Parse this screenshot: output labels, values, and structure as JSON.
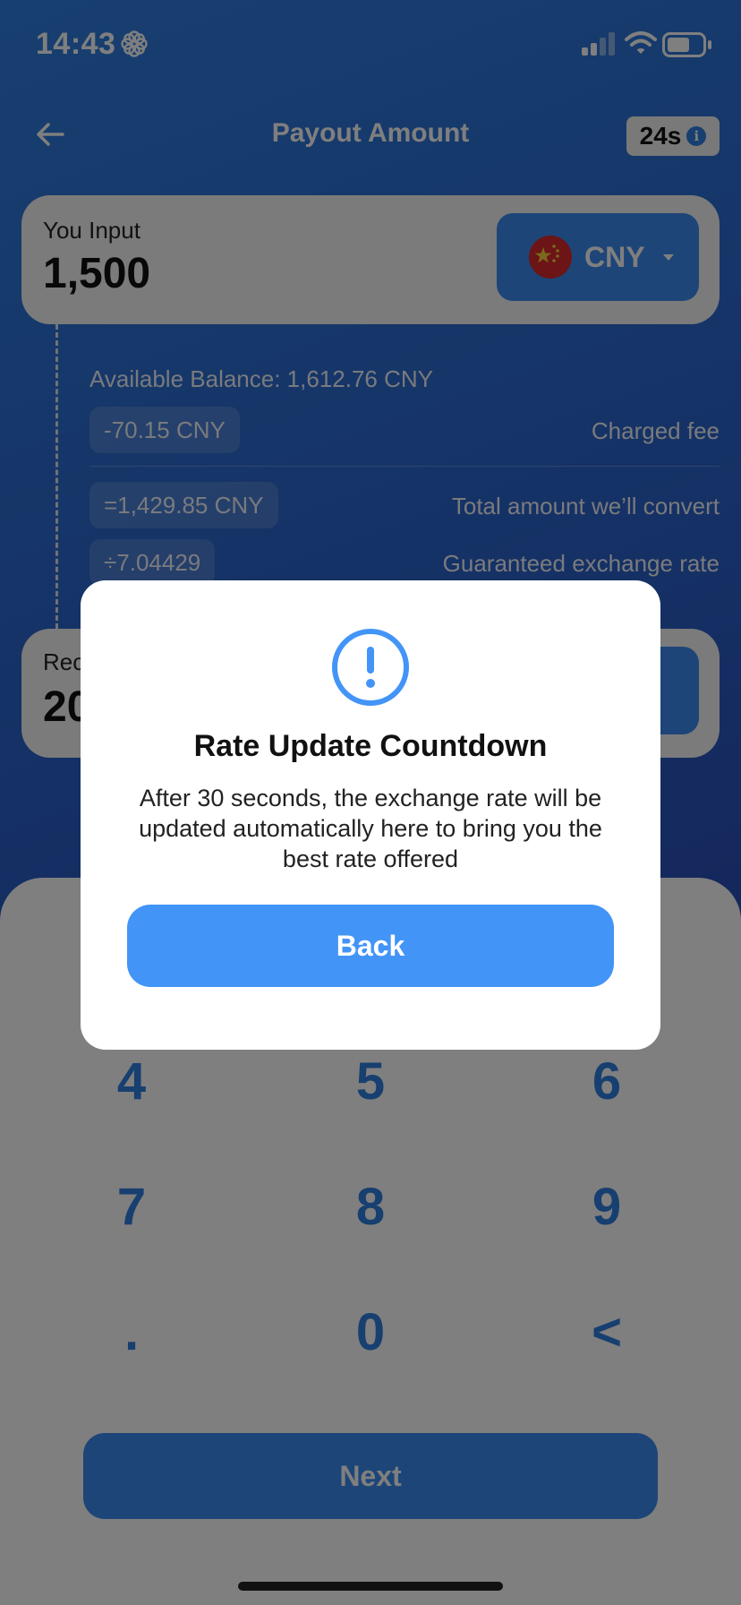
{
  "status_bar": {
    "time": "14:43"
  },
  "header": {
    "title": "Payout Amount",
    "timer": "24s"
  },
  "input_card": {
    "label": "You Input",
    "value": "1,500",
    "currency": "CNY"
  },
  "details": {
    "balance": "Available Balance: 1,612.76 CNY",
    "fee_value": "-70.15 CNY",
    "fee_label": "Charged fee",
    "total_value": "=1,429.85 CNY",
    "total_label": "Total amount we’ll convert",
    "rate_value": "÷7.04429",
    "rate_label": "Guaranteed exchange rate"
  },
  "receive_card": {
    "label_partial": "Rec",
    "value_partial": "20"
  },
  "keypad": {
    "keys": [
      "4",
      "5",
      "6",
      "7",
      "8",
      "9",
      ".",
      "0",
      "<"
    ],
    "next_label": "Next"
  },
  "modal": {
    "title": "Rate Update Countdown",
    "body": "After 30 seconds, the exchange rate will be updated automatically here to bring you the best rate offered",
    "back_label": "Back"
  },
  "colors": {
    "accent": "#3a8bf0",
    "modal_button": "#4394f7",
    "flag_red": "#d8282c",
    "flag_yellow": "#f6d23a"
  }
}
